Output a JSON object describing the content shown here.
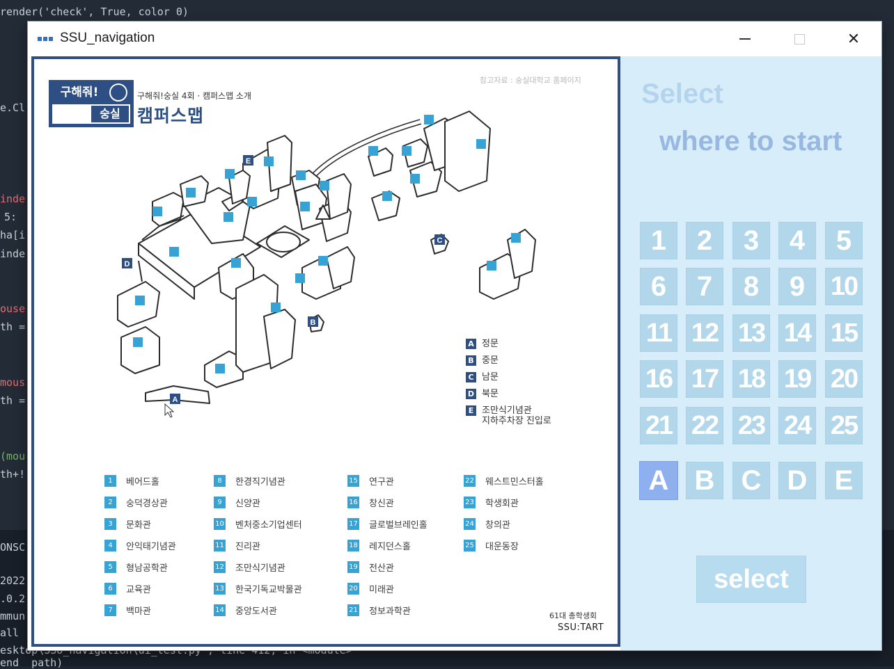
{
  "background_editor": {
    "lines": [
      {
        "text": "render('check', True, color 0)"
      },
      {
        "text": "e.Cl"
      },
      {
        "text": "inde"
      },
      {
        "text": "5:"
      },
      {
        "text": "ha[i"
      },
      {
        "text": "inde"
      },
      {
        "text": "ouse"
      },
      {
        "text": "th ="
      },
      {
        "text": "mous"
      },
      {
        "text": "th ="
      },
      {
        "text": "(mou"
      },
      {
        "text": "th+!"
      },
      {
        "text": "ONSC"
      },
      {
        "text": "2022"
      },
      {
        "text": ".0.2"
      },
      {
        "text": "mmun"
      },
      {
        "text": "all"
      },
      {
        "text": "esktop\\SSU_navigation\\ui_test.py\", line 412, in <module>"
      },
      {
        "text": "end  path)"
      }
    ]
  },
  "window": {
    "title": "SSU_navigation",
    "controls": {
      "minimize": "",
      "maximize": "",
      "close": "✕"
    }
  },
  "map": {
    "reference": "참고자료 : 숭실대학교 홈페이지",
    "brand": {
      "row1": "구해줘!",
      "row2": "숭실",
      "subtitle": "구해줘!숭실 4회 · 캠퍼스맵 소개",
      "title": "캠퍼스맵"
    },
    "gates": [
      {
        "tag": "A",
        "label": "정문"
      },
      {
        "tag": "B",
        "label": "중문"
      },
      {
        "tag": "C",
        "label": "남문"
      },
      {
        "tag": "D",
        "label": "북문"
      },
      {
        "tag": "E",
        "label": "조만식기념관\n지하주차장 진입로"
      }
    ],
    "buildings": [
      {
        "num": "1",
        "name": "베어드홀"
      },
      {
        "num": "2",
        "name": "숭덕경상관"
      },
      {
        "num": "3",
        "name": "문화관"
      },
      {
        "num": "4",
        "name": "안익태기념관"
      },
      {
        "num": "5",
        "name": "형남공학관"
      },
      {
        "num": "6",
        "name": "교육관"
      },
      {
        "num": "7",
        "name": "백마관"
      },
      {
        "num": "8",
        "name": "한경직기념관"
      },
      {
        "num": "9",
        "name": "신양관"
      },
      {
        "num": "10",
        "name": "벤처중소기업센터"
      },
      {
        "num": "11",
        "name": "진리관"
      },
      {
        "num": "12",
        "name": "조만식기념관"
      },
      {
        "num": "13",
        "name": "한국기독교박물관"
      },
      {
        "num": "14",
        "name": "중앙도서관"
      },
      {
        "num": "15",
        "name": "연구관"
      },
      {
        "num": "16",
        "name": "창신관"
      },
      {
        "num": "17",
        "name": "글로벌브레인홀"
      },
      {
        "num": "18",
        "name": "레지던스홀"
      },
      {
        "num": "19",
        "name": "전산관"
      },
      {
        "num": "20",
        "name": "미래관"
      },
      {
        "num": "21",
        "name": "정보과학관"
      },
      {
        "num": "22",
        "name": "웨스트민스터홀"
      },
      {
        "num": "23",
        "name": "학생회관"
      },
      {
        "num": "24",
        "name": "창의관"
      },
      {
        "num": "25",
        "name": "대운동장"
      }
    ],
    "credit_line1": "61대 총학생회",
    "credit_line2": "SSU:TART"
  },
  "panel": {
    "heading": "Select",
    "subheading": "where to start",
    "options": [
      "1",
      "2",
      "3",
      "4",
      "5",
      "6",
      "7",
      "8",
      "9",
      "10",
      "11",
      "12",
      "13",
      "14",
      "15",
      "16",
      "17",
      "18",
      "19",
      "20",
      "21",
      "22",
      "23",
      "24",
      "25",
      "A",
      "B",
      "C",
      "D",
      "E"
    ],
    "selected": "A",
    "select_button": "select",
    "colors": {
      "button": "#b2d7eb",
      "active": "#8fb0ef",
      "panel": "#d7eefa"
    }
  }
}
